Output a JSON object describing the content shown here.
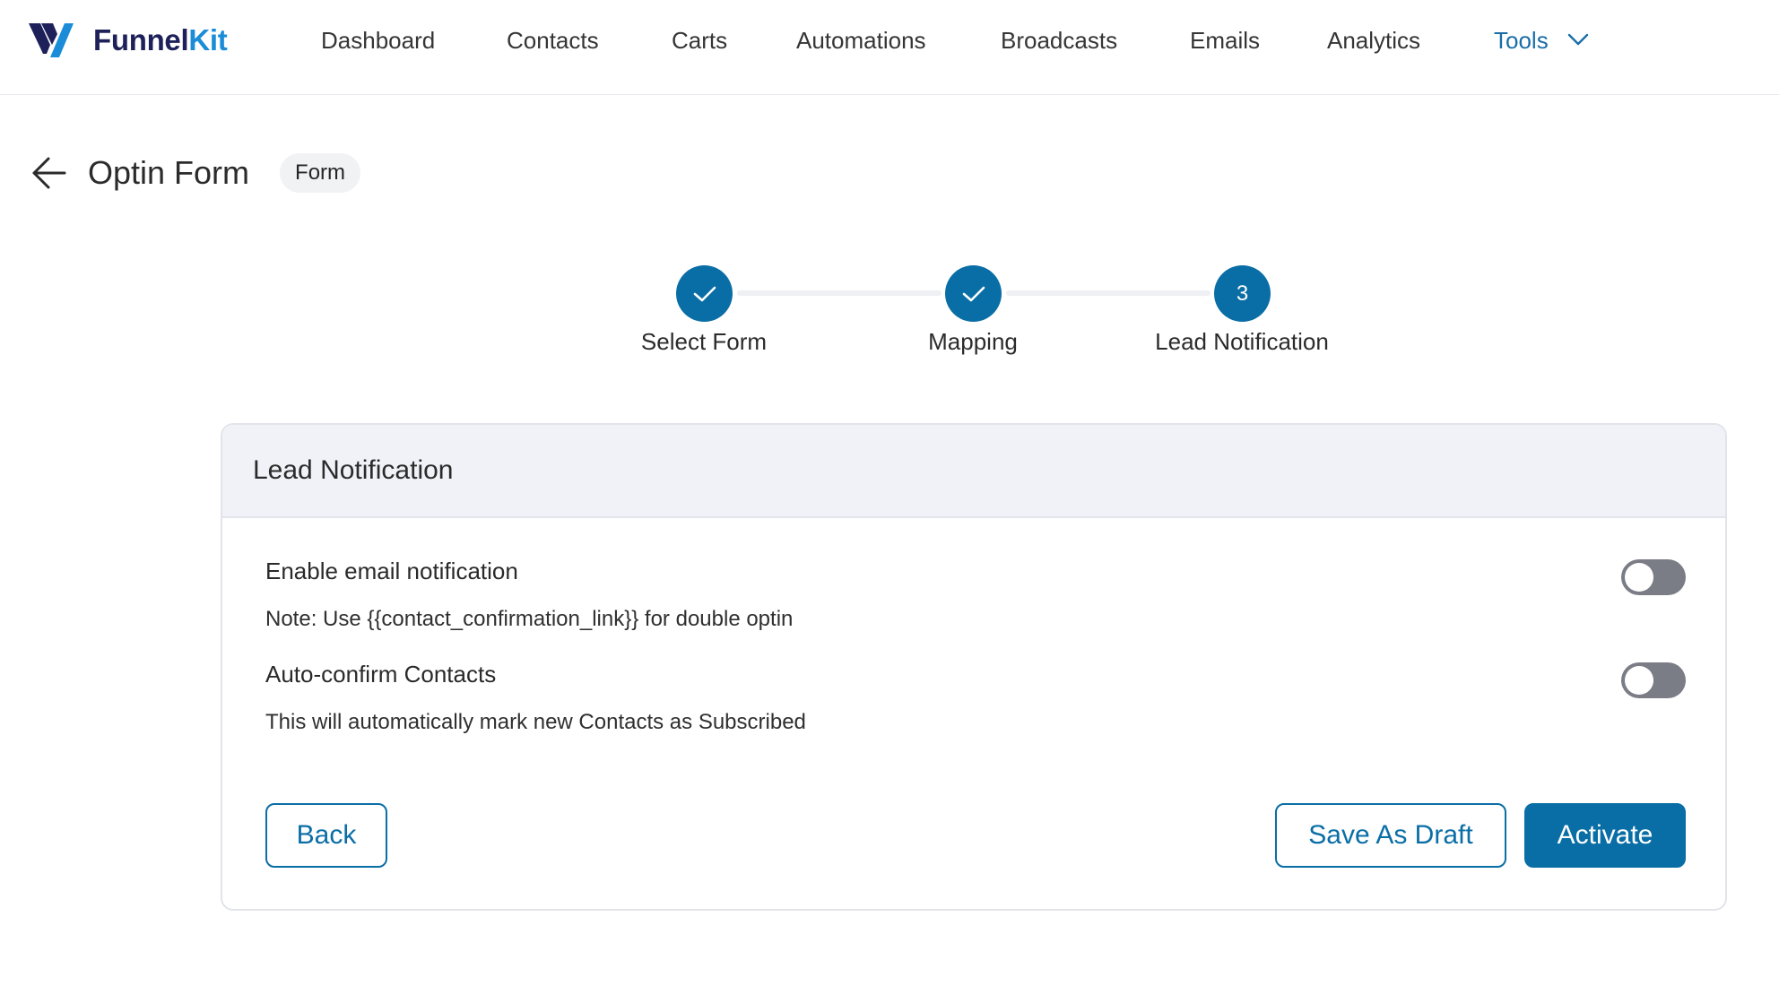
{
  "brand": {
    "name_main": "Funnel",
    "name_accent": "Kit",
    "colors": {
      "navy": "#1e2159",
      "blue": "#1a8cd8",
      "primary": "#0a6ea6"
    }
  },
  "nav": {
    "items": [
      {
        "label": "Dashboard"
      },
      {
        "label": "Contacts"
      },
      {
        "label": "Carts"
      },
      {
        "label": "Automations"
      },
      {
        "label": "Broadcasts"
      },
      {
        "label": "Emails"
      },
      {
        "label": "Analytics"
      },
      {
        "label": "Tools",
        "active": true,
        "icon": "chevron-down-icon"
      }
    ]
  },
  "page": {
    "title": "Optin Form",
    "badge": "Form",
    "back_icon": "arrow-left-icon"
  },
  "stepper": {
    "steps": [
      {
        "label": "Select Form",
        "state": "completed",
        "icon": "checkmark-icon"
      },
      {
        "label": "Mapping",
        "state": "completed",
        "icon": "checkmark-icon"
      },
      {
        "label": "Lead Notification",
        "state": "current",
        "number": "3"
      }
    ]
  },
  "card": {
    "title": "Lead Notification",
    "settings": [
      {
        "title": "Enable email notification",
        "description": "Note: Use {{contact_confirmation_link}} for double optin",
        "enabled": false
      },
      {
        "title": "Auto-confirm Contacts",
        "description": "This will automatically mark new Contacts as Subscribed",
        "enabled": false
      }
    ],
    "buttons": {
      "back": "Back",
      "save_draft": "Save As Draft",
      "activate": "Activate"
    }
  }
}
